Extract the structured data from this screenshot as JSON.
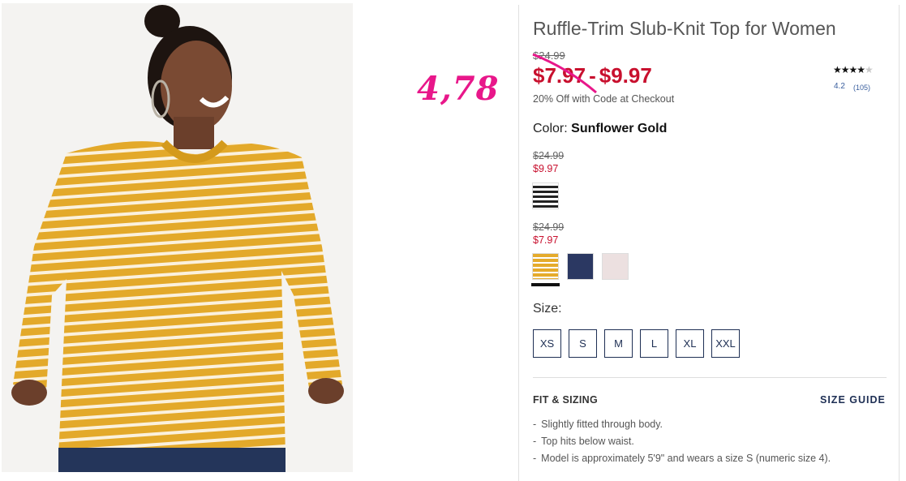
{
  "annotation": "4,78",
  "product": {
    "title": "Ruffle-Trim Slub-Knit Top for Women",
    "old_price": "$24.99",
    "price_low": "$7.97",
    "price_separator": "-",
    "price_high": "$9.97",
    "promo": "20% Off with Code at Checkout"
  },
  "rating": {
    "stars": 4,
    "max": 5,
    "value": "4.2",
    "count": "(105)"
  },
  "color": {
    "label": "Color:",
    "selected": "Sunflower Gold"
  },
  "price_groups": [
    {
      "old": "$24.99",
      "new": "$9.97",
      "swatches": [
        "navy-white-stripe"
      ]
    },
    {
      "old": "$24.99",
      "new": "$7.97",
      "swatches": [
        "sunflower-gold-stripe",
        "navy",
        "blush"
      ]
    }
  ],
  "size": {
    "label": "Size:",
    "options": [
      "XS",
      "S",
      "M",
      "L",
      "XL",
      "XXL"
    ]
  },
  "fit": {
    "title": "FIT & SIZING",
    "size_guide": "SIZE GUIDE",
    "items": [
      "Slightly fitted through body.",
      "Top hits below waist.",
      "Model is approximately 5'9\" and wears a size S (numeric size 4)."
    ]
  },
  "colors": {
    "sale_red": "#c8102e",
    "annotation_pink": "#e8178a",
    "navy": "#1e2f54",
    "gold": "#e5ab2c"
  }
}
